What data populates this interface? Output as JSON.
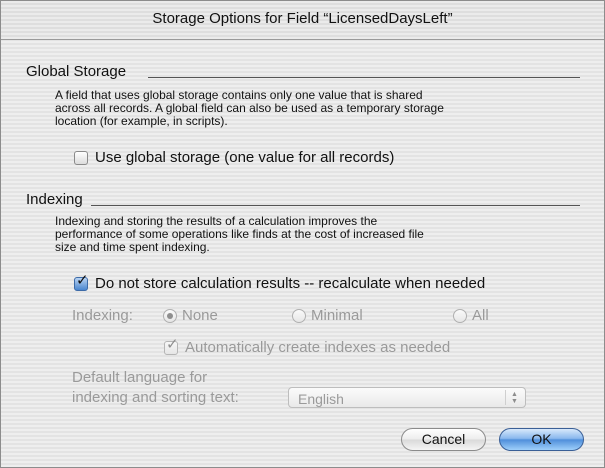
{
  "dialog": {
    "title": "Storage Options for Field “LicensedDaysLeft”"
  },
  "global_storage": {
    "heading": "Global Storage",
    "description": [
      "A field that uses global storage contains only one value that is shared",
      "across all records.  A global field can also be used as a temporary storage",
      "location (for example, in scripts)."
    ],
    "checkbox_label": "Use global storage (one value for all records)",
    "checked": false
  },
  "indexing": {
    "heading": "Indexing",
    "description": [
      "Indexing and storing the results of a calculation improves the",
      "performance of some operations like finds at the cost of increased file",
      "size and time spent indexing."
    ],
    "no_store_label": "Do not store calculation results -- recalculate when needed",
    "no_store_checked": true,
    "radio_group_label": "Indexing:",
    "radio_options": [
      "None",
      "Minimal",
      "All"
    ],
    "radio_selected": "None",
    "auto_index_label": "Automatically create indexes as needed",
    "auto_index_checked": true,
    "language_label_line1": "Default language for",
    "language_label_line2": "indexing and sorting text:",
    "language_value": "English"
  },
  "buttons": {
    "cancel": "Cancel",
    "ok": "OK"
  },
  "colors": {
    "default_button": "#4f8fdb",
    "disabled_text": "#9a9a9a",
    "checkbox_checked": "#4a86cf"
  }
}
